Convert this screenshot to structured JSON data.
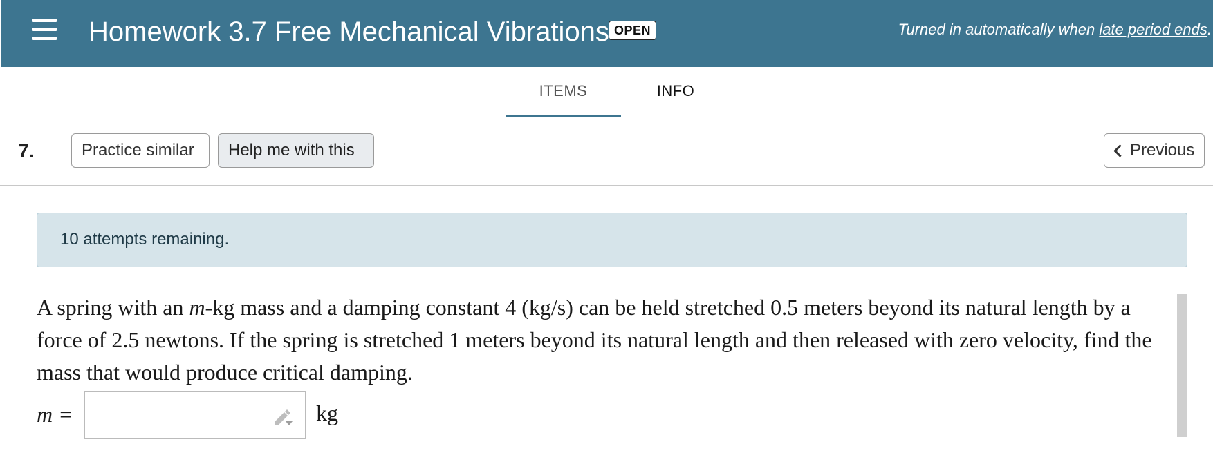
{
  "header": {
    "title": "Homework 3.7 Free Mechanical Vibrations",
    "status_badge": "OPEN",
    "turnin_text": "Turned in automatically when ",
    "turnin_link": "late period ends",
    "turnin_suffix": ".",
    "menu_icon": "hamburger-menu-icon",
    "background_color": "#3d7590"
  },
  "tabs": [
    {
      "label": "ITEMS",
      "active": true
    },
    {
      "label": "INFO",
      "active": false
    }
  ],
  "toolbar": {
    "question_number": "7.",
    "practice_label": "Practice similar",
    "help_label": "Help me with this",
    "previous_label": "Previous",
    "previous_icon": "chevron-left-icon"
  },
  "attempts": {
    "text": "10 attempts remaining."
  },
  "question": {
    "part1": "A spring with an ",
    "var": "m",
    "part2": "-kg mass and a damping constant 4 (kg/s) can be held stretched 0.5 meters beyond its natural length by a force of 2.5 newtons. If the spring is stretched 1 meters beyond its natural length and then released with zero velocity, find the mass that would produce critical damping."
  },
  "answer": {
    "label": "m =",
    "value": "",
    "unit": "kg",
    "input_icon": "pencil-dropdown-icon"
  }
}
